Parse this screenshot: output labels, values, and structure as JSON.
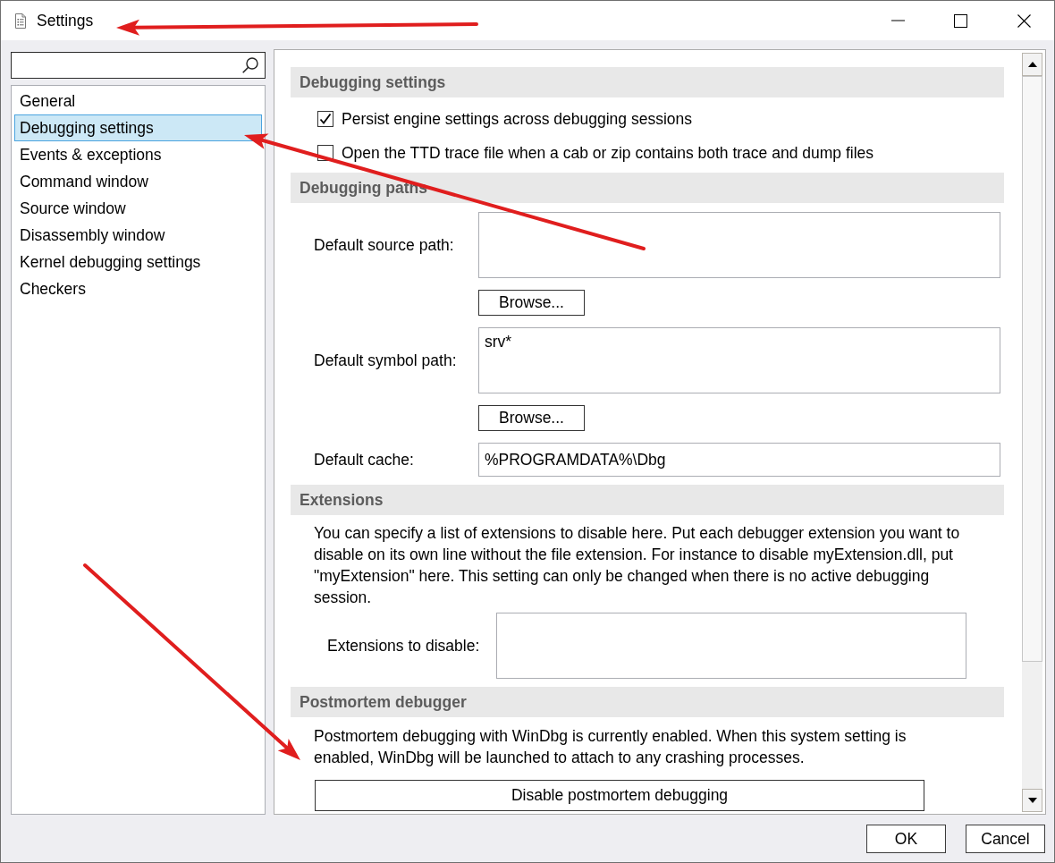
{
  "window": {
    "title": "Settings"
  },
  "sidebar": {
    "items": [
      {
        "label": "General",
        "selected": false
      },
      {
        "label": "Debugging settings",
        "selected": true
      },
      {
        "label": "Events & exceptions",
        "selected": false
      },
      {
        "label": "Command window",
        "selected": false
      },
      {
        "label": "Source window",
        "selected": false
      },
      {
        "label": "Disassembly window",
        "selected": false
      },
      {
        "label": "Kernel debugging settings",
        "selected": false
      },
      {
        "label": "Checkers",
        "selected": false
      }
    ]
  },
  "sections": [
    {
      "title": "Debugging settings",
      "kind": "checklist",
      "rows": [
        {
          "kind": "checkbox",
          "label": "Persist engine settings across debugging sessions",
          "checked": true
        },
        {
          "kind": "checkbox",
          "label": "Open the TTD trace file when a cab or zip contains both trace and dump files",
          "checked": false
        }
      ]
    },
    {
      "title": "Debugging paths",
      "kind": "form",
      "rows": [
        {
          "kind": "path",
          "label": "Default source path:",
          "button": "Browse..."
        },
        {
          "kind": "path",
          "label": "Default symbol path:",
          "value": "srv*",
          "button": "Browse..."
        },
        {
          "kind": "input",
          "label": "Default cache:",
          "value": "%PROGRAMDATA%\\Dbg"
        }
      ]
    },
    {
      "title": "Extensions",
      "kind": "notice",
      "rows": [
        {
          "kind": "paragraph",
          "text": "You can specify a list of extensions to disable here. Put each debugger extension you want to disable on its own line without the file extension. For instance to disable myExtension.dll, put \"myExtension\" here. This setting can only be changed when there is no active debugging session."
        },
        {
          "kind": "textarea",
          "label": "Extensions to disable:"
        }
      ]
    },
    {
      "title": "Postmortem debugger",
      "kind": "notice",
      "rows": [
        {
          "kind": "paragraph",
          "text": "Postmortem debugging with WinDbg is currently enabled. When this system setting is enabled, WinDbg will be launched to attach to any crashing processes."
        },
        {
          "kind": "command",
          "label": "Disable postmortem debugging"
        }
      ]
    }
  ],
  "buttons": [
    {
      "label": "OK"
    },
    {
      "label": "Cancel"
    }
  ]
}
